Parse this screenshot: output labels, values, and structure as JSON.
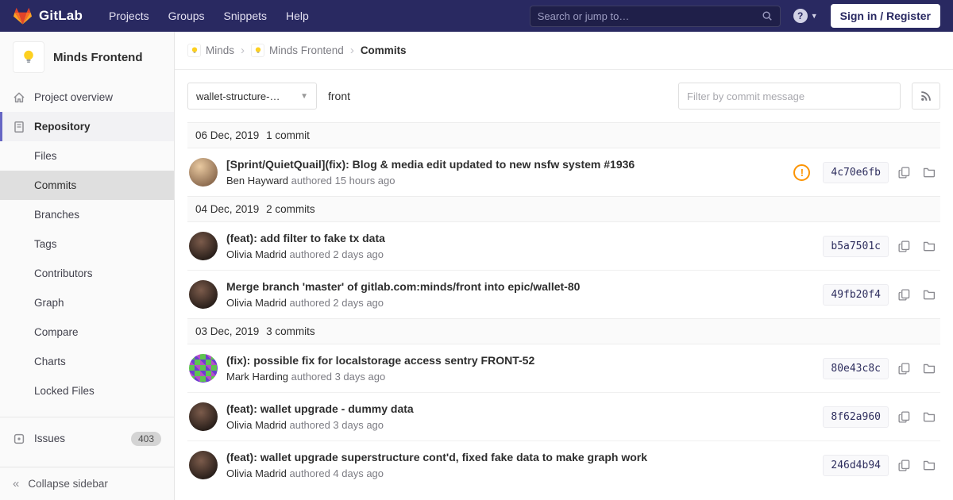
{
  "colors": {
    "navbar_bg": "#292961",
    "brand_orange": "#fc6d26",
    "warning_orange": "#fc9403",
    "active_indicator": "#6666c4"
  },
  "navbar": {
    "brand": "GitLab",
    "links": [
      "Projects",
      "Groups",
      "Snippets",
      "Help"
    ],
    "search_placeholder": "Search or jump to…",
    "sign_in_label": "Sign in / Register"
  },
  "sidebar": {
    "project_title": "Minds Frontend",
    "project_avatar_icon": "lightbulb",
    "overview_label": "Project overview",
    "repository_label": "Repository",
    "repository_items": [
      "Files",
      "Commits",
      "Branches",
      "Tags",
      "Contributors",
      "Graph",
      "Compare",
      "Charts",
      "Locked Files"
    ],
    "issues_label": "Issues",
    "issues_badge": "403",
    "collapse_label": "Collapse sidebar"
  },
  "breadcrumb": {
    "crumbs": [
      "Minds",
      "Minds Frontend",
      "Commits"
    ]
  },
  "controls": {
    "branch": "wallet-structure-…",
    "path_label": "front",
    "filter_placeholder": "Filter by commit message"
  },
  "commit_groups": [
    {
      "date": "06 Dec, 2019",
      "count": "1 commit",
      "commits": [
        {
          "title": "[Sprint/QuietQuail](fix): Blog & media edit updated to new nsfw system #1936",
          "author": "Ben Hayward",
          "meta": "authored 15 hours ago",
          "sha": "4c70e6fb",
          "avatar": "photo-light",
          "warning": true
        }
      ]
    },
    {
      "date": "04 Dec, 2019",
      "count": "2 commits",
      "commits": [
        {
          "title": "(feat): add filter to fake tx data",
          "author": "Olivia Madrid",
          "meta": "authored 2 days ago",
          "sha": "b5a7501c",
          "avatar": "photo-dark",
          "warning": false
        },
        {
          "title": "Merge branch 'master' of gitlab.com:minds/front into epic/wallet-80",
          "author": "Olivia Madrid",
          "meta": "authored 2 days ago",
          "sha": "49fb20f4",
          "avatar": "photo-dark",
          "warning": false
        }
      ]
    },
    {
      "date": "03 Dec, 2019",
      "count": "3 commits",
      "commits": [
        {
          "title": "(fix): possible fix for localstorage access sentry FRONT-52",
          "author": "Mark Harding",
          "meta": "authored 3 days ago",
          "sha": "80e43c8c",
          "avatar": "identicon",
          "warning": false
        },
        {
          "title": "(feat): wallet upgrade - dummy data",
          "author": "Olivia Madrid",
          "meta": "authored 3 days ago",
          "sha": "8f62a960",
          "avatar": "photo-dark",
          "warning": false
        },
        {
          "title": "(feat): wallet upgrade superstructure cont'd, fixed fake data to make graph work",
          "author": "Olivia Madrid",
          "meta": "authored 4 days ago",
          "sha": "246d4b94",
          "avatar": "photo-dark",
          "warning": false
        }
      ]
    }
  ]
}
